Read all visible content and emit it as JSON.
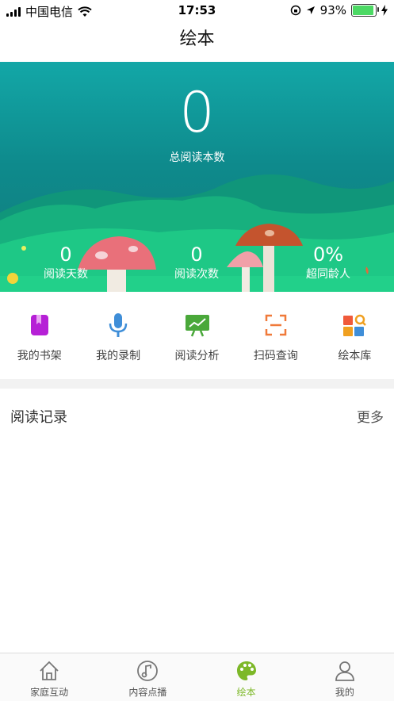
{
  "status_bar": {
    "carrier": "中国电信",
    "time": "17:53",
    "battery_percent": "93%"
  },
  "header": {
    "title": "绘本"
  },
  "hero": {
    "total_count": "0",
    "total_label": "总阅读本数",
    "stats": [
      {
        "value": "0",
        "label": "阅读天数"
      },
      {
        "value": "0",
        "label": "阅读次数"
      },
      {
        "value": "0%",
        "label": "超同龄人"
      }
    ]
  },
  "quick_menu": [
    {
      "label": "我的书架",
      "icon": "bookshelf-icon",
      "color": "#b620d6"
    },
    {
      "label": "我的录制",
      "icon": "microphone-icon",
      "color": "#3f8ed8"
    },
    {
      "label": "阅读分析",
      "icon": "chart-board-icon",
      "color": "#4aa83a"
    },
    {
      "label": "扫码查询",
      "icon": "scan-icon",
      "color": "#f07a3a"
    },
    {
      "label": "绘本库",
      "icon": "library-icon",
      "color": "#f0a020"
    }
  ],
  "reading_record": {
    "title": "阅读记录",
    "more": "更多"
  },
  "tab_bar": [
    {
      "label": "家庭互动",
      "icon": "home-icon",
      "active": false
    },
    {
      "label": "内容点播",
      "icon": "music-note-icon",
      "active": false
    },
    {
      "label": "绘本",
      "icon": "palette-icon",
      "active": true
    },
    {
      "label": "我的",
      "icon": "person-icon",
      "active": false
    }
  ],
  "colors": {
    "accent_active_tab": "#7db828",
    "hero_top": "#13a7a7",
    "hero_green": "#1ebe7e"
  }
}
